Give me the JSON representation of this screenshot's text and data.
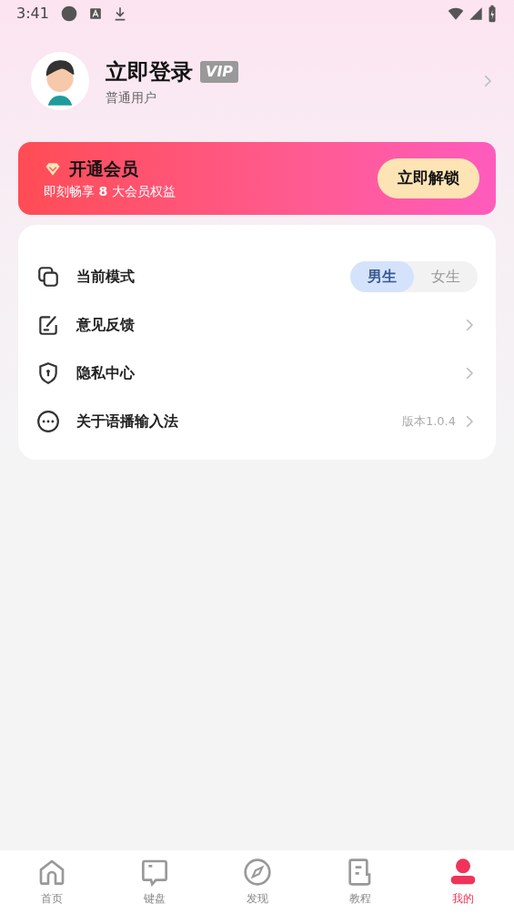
{
  "status_bar": {
    "time": "3:41"
  },
  "profile": {
    "name": "立即登录",
    "vip_badge": "VIP",
    "subtitle": "普通用户"
  },
  "vip_banner": {
    "title": "开通会员",
    "subtitle": "即刻畅享 **8** 大会员权益",
    "button": "立即解锁"
  },
  "menu": [
    {
      "kind": "toggle",
      "label": "当前模式",
      "options": [
        {
          "label": "男生",
          "selected": true
        },
        {
          "label": "女生",
          "selected": false
        }
      ]
    },
    {
      "kind": "link",
      "label": "意见反馈"
    },
    {
      "kind": "link",
      "label": "隐私中心"
    },
    {
      "kind": "version",
      "label": "关于语播输入法",
      "value": "版本1.0.4"
    }
  ],
  "tabs": [
    {
      "label": "首页",
      "selected": false
    },
    {
      "label": "键盘",
      "selected": false
    },
    {
      "label": "发现",
      "selected": false
    },
    {
      "label": "教程",
      "selected": false
    },
    {
      "label": "我的",
      "selected": true
    }
  ]
}
